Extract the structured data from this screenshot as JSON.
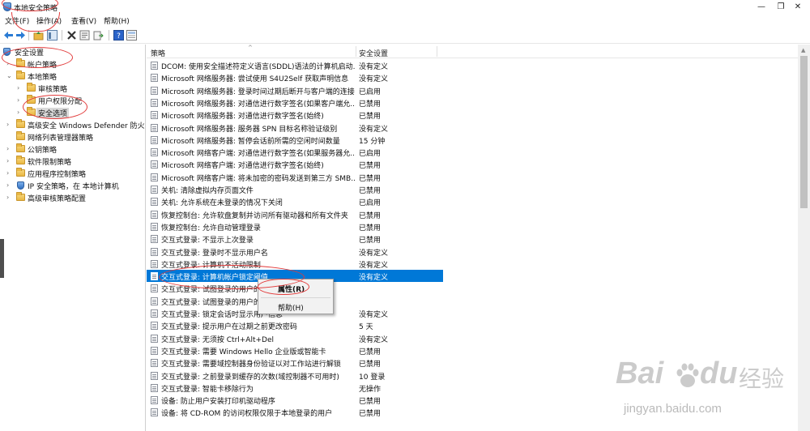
{
  "window": {
    "title": "本地安全策略",
    "minimize_glyph": "—",
    "maximize_glyph": "❐",
    "close_glyph": "✕"
  },
  "menu": [
    "文件(F)",
    "操作(A)",
    "查看(V)",
    "帮助(H)"
  ],
  "toolbar_icons": [
    "back-icon",
    "forward-icon",
    "up-folder-icon",
    "show-pane-icon",
    "delete-icon",
    "properties-icon",
    "export-icon",
    "help-icon",
    "view-icon"
  ],
  "tree": [
    {
      "label": "安全设置",
      "expander": "",
      "icon": "shield"
    },
    {
      "label": "帐户策略",
      "expander": "›",
      "icon": "folder"
    },
    {
      "label": "本地策略",
      "expander": "⌄",
      "icon": "folder"
    },
    {
      "label": "审核策略",
      "expander": "›",
      "icon": "folder"
    },
    {
      "label": "用户权限分配",
      "expander": "›",
      "icon": "folder"
    },
    {
      "label": "安全选项",
      "expander": "›",
      "icon": "folder"
    },
    {
      "label": "高级安全 Windows Defender 防火墙",
      "expander": "›",
      "icon": "folder"
    },
    {
      "label": "网络列表管理器策略",
      "expander": "",
      "icon": "folder"
    },
    {
      "label": "公钥策略",
      "expander": "›",
      "icon": "folder"
    },
    {
      "label": "软件限制策略",
      "expander": "›",
      "icon": "folder"
    },
    {
      "label": "应用程序控制策略",
      "expander": "›",
      "icon": "folder"
    },
    {
      "label": "IP 安全策略，在 本地计算机",
      "expander": "›",
      "icon": "shield"
    },
    {
      "label": "高级审核策略配置",
      "expander": "›",
      "icon": "folder"
    }
  ],
  "list": {
    "col_policy": "策略",
    "col_setting": "安全设置",
    "sort_caret": "^",
    "rows": [
      {
        "policy": "DCOM: 使用安全描述符定义语言(SDDL)语法的计算机启动...",
        "setting": "没有定义"
      },
      {
        "policy": "Microsoft 网络服务器: 尝试使用 S4U2Self 获取声明信息",
        "setting": "没有定义"
      },
      {
        "policy": "Microsoft 网络服务器: 登录时间过期后断开与客户端的连接",
        "setting": "已启用"
      },
      {
        "policy": "Microsoft 网络服务器: 对通信进行数字签名(如果客户端允...",
        "setting": "已禁用"
      },
      {
        "policy": "Microsoft 网络服务器: 对通信进行数字签名(始终)",
        "setting": "已禁用"
      },
      {
        "policy": "Microsoft 网络服务器: 服务器 SPN 目标名称验证级别",
        "setting": "没有定义"
      },
      {
        "policy": "Microsoft 网络服务器: 暂停会话前所需的空闲时间数量",
        "setting": "15 分钟"
      },
      {
        "policy": "Microsoft 网络客户端: 对通信进行数字签名(如果服务器允...",
        "setting": "已启用"
      },
      {
        "policy": "Microsoft 网络客户端: 对通信进行数字签名(始终)",
        "setting": "已禁用"
      },
      {
        "policy": "Microsoft 网络客户端: 将未加密的密码发送到第三方 SMB...",
        "setting": "已禁用"
      },
      {
        "policy": "关机: 清除虚拟内存页面文件",
        "setting": "已禁用"
      },
      {
        "policy": "关机: 允许系统在未登录的情况下关闭",
        "setting": "已启用"
      },
      {
        "policy": "恢复控制台: 允许软盘复制并访问所有驱动器和所有文件夹",
        "setting": "已禁用"
      },
      {
        "policy": "恢复控制台: 允许自动管理登录",
        "setting": "已禁用"
      },
      {
        "policy": "交互式登录: 不显示上次登录",
        "setting": "已禁用"
      },
      {
        "policy": "交互式登录: 登录时不显示用户名",
        "setting": "没有定义"
      },
      {
        "policy": "交互式登录: 计算机不活动限制",
        "setting": "没有定义"
      },
      {
        "policy": "交互式登录: 计算机帐户锁定阈值",
        "setting": "没有定义"
      },
      {
        "policy": "交互式登录: 试图登录的用户的",
        "setting": ""
      },
      {
        "policy": "交互式登录: 试图登录的用户的",
        "setting": ""
      },
      {
        "policy": "交互式登录: 锁定会话时显示用户信息",
        "setting": "没有定义"
      },
      {
        "policy": "交互式登录: 提示用户在过期之前更改密码",
        "setting": "5 天"
      },
      {
        "policy": "交互式登录: 无须按 Ctrl+Alt+Del",
        "setting": "没有定义"
      },
      {
        "policy": "交互式登录: 需要 Windows Hello 企业版或智能卡",
        "setting": "已禁用"
      },
      {
        "policy": "交互式登录: 需要域控制器身份验证以对工作站进行解锁",
        "setting": "已禁用"
      },
      {
        "policy": "交互式登录: 之前登录到缓存的次数(域控制器不可用时)",
        "setting": "10 登录"
      },
      {
        "policy": "交互式登录: 智能卡移除行为",
        "setting": "无操作"
      },
      {
        "policy": "设备: 防止用户安装打印机驱动程序",
        "setting": "已禁用"
      },
      {
        "policy": "设备: 将 CD-ROM 的访问权限仅限于本地登录的用户",
        "setting": "已禁用"
      }
    ],
    "selected_index": 17
  },
  "context_menu": {
    "properties": "属性(R)",
    "help": "帮助(H)"
  },
  "watermark": {
    "brand": "Bai",
    "brand_tail": "du",
    "chinese": "经验",
    "url": "jingyan.baidu.com"
  },
  "colors": {
    "selection": "#0078d7",
    "annotation": "#e23b3b"
  }
}
